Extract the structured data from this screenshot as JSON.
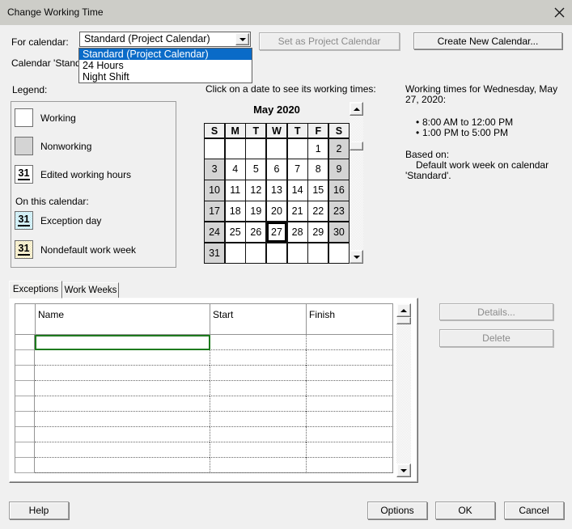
{
  "window": {
    "title": "Change Working Time"
  },
  "for_calendar": {
    "label": "For calendar:",
    "value": "Standard (Project Calendar)",
    "options": [
      "Standard (Project Calendar)",
      "24 Hours",
      "Night Shift"
    ],
    "selected_index": 0
  },
  "base_calendar_note": "Calendar 'Standard' is a base calendar.",
  "toolbar": {
    "set_as_project_label": "Set as Project Calendar",
    "create_new_label": "Create New Calendar..."
  },
  "legend": {
    "label": "Legend:",
    "items": [
      {
        "key": "working",
        "label": "Working",
        "glyph": ""
      },
      {
        "key": "nonworking",
        "label": "Nonworking",
        "glyph": ""
      },
      {
        "key": "edited",
        "label": "Edited working hours",
        "glyph": "31"
      }
    ],
    "on_this_calendar_label": "On this calendar:",
    "calendar_items": [
      {
        "key": "exception",
        "label": "Exception day",
        "glyph": "31"
      },
      {
        "key": "nondefault",
        "label": "Nondefault work week",
        "glyph": "31"
      }
    ]
  },
  "calendar": {
    "hint": "Click on a date to see its working times:",
    "month_title": "May 2020",
    "day_headers": [
      "S",
      "M",
      "T",
      "W",
      "T",
      "F",
      "S"
    ],
    "weeks": [
      [
        "",
        "",
        "",
        "",
        "",
        "1",
        "2"
      ],
      [
        "3",
        "4",
        "5",
        "6",
        "7",
        "8",
        "9"
      ],
      [
        "10",
        "11",
        "12",
        "13",
        "14",
        "15",
        "16"
      ],
      [
        "17",
        "18",
        "19",
        "20",
        "21",
        "22",
        "23"
      ],
      [
        "24",
        "25",
        "26",
        "27",
        "28",
        "29",
        "30"
      ],
      [
        "31",
        "",
        "",
        "",
        "",
        "",
        ""
      ]
    ],
    "nonworking_days": [
      "2",
      "3",
      "9",
      "10",
      "16",
      "17",
      "23",
      "24",
      "30",
      "31"
    ],
    "selected_day": "27"
  },
  "working_times": {
    "heading_lines": [
      "Working times for Wednesday, May",
      "27, 2020:"
    ],
    "times": [
      "8:00 AM to 12:00 PM",
      "1:00 PM to 5:00 PM"
    ],
    "based_on_label": "Based on:",
    "based_on_lines": [
      "Default work week on calendar",
      "'Standard'."
    ]
  },
  "tabs": [
    {
      "label": "Exceptions",
      "active": true
    },
    {
      "label": "Work Weeks",
      "active": false
    }
  ],
  "exceptions_table": {
    "columns": [
      "Name",
      "Start",
      "Finish"
    ],
    "row_count": 9,
    "rows": [
      [
        "",
        "",
        ""
      ],
      [
        "",
        "",
        ""
      ],
      [
        "",
        "",
        ""
      ],
      [
        "",
        "",
        ""
      ],
      [
        "",
        "",
        ""
      ],
      [
        "",
        "",
        ""
      ],
      [
        "",
        "",
        ""
      ],
      [
        "",
        "",
        ""
      ],
      [
        "",
        "",
        ""
      ]
    ],
    "selected_cell": {
      "row": 0,
      "column": "Name"
    }
  },
  "side_buttons": {
    "details_label": "Details...",
    "delete_label": "Delete"
  },
  "footer": {
    "help_label": "Help",
    "options_label": "Options",
    "ok_label": "OK",
    "cancel_label": "Cancel"
  },
  "colors": {
    "dialog_bg": "#f0f0f0",
    "titlebar_bg": "#cdcdc8",
    "selection_blue": "#0a6bc8",
    "selected_cell_green": "#1e7a1e",
    "nonworking_gray": "#d4d4d4",
    "exception_cyan": "#d9f1f8",
    "nondefault_yellow": "#fcf8e1"
  }
}
